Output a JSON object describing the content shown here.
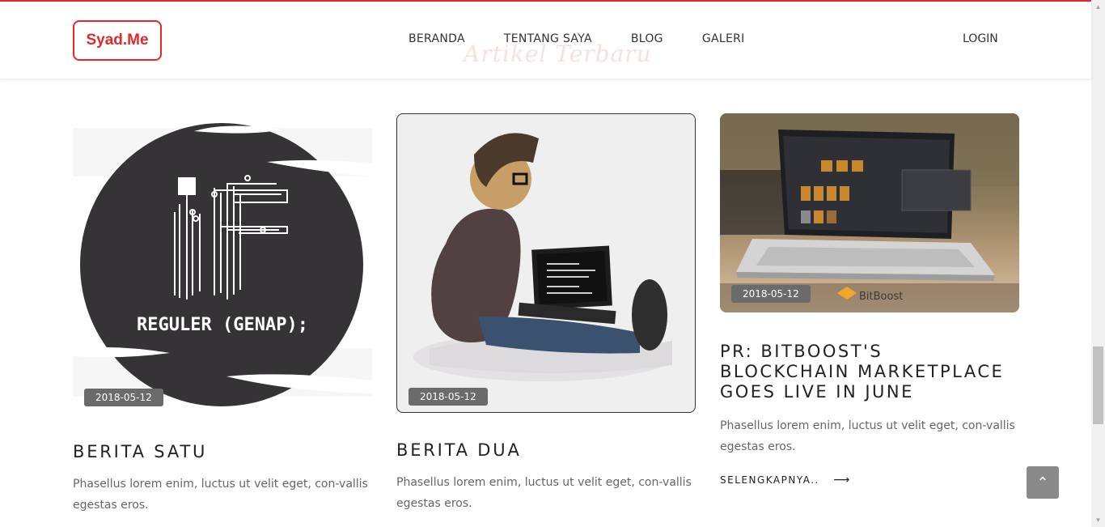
{
  "nav": {
    "logo": "Syad.Me",
    "links": [
      "BERANDA",
      "TENTANG SAYA",
      "BLOG",
      "GALERI"
    ],
    "login": "LOGIN"
  },
  "section": {
    "ghost_title": "Artikel Terbaru"
  },
  "cards": [
    {
      "image_caption": "REGULER (GENAP);",
      "date": "2018-05-12",
      "title": "BERITA SATU",
      "text": "Phasellus lorem enim, luctus ut velit eget, con-vallis egestas eros."
    },
    {
      "date": "2018-05-12",
      "title": "BERITA DUA",
      "text": "Phasellus lorem enim, luctus ut velit eget, con-vallis egestas eros."
    },
    {
      "image_caption": "BitBoost",
      "date": "2018-05-12",
      "title": "PR: BITBOOST'S BLOCKCHAIN MARKETPLACE GOES LIVE IN JUNE",
      "text": "Phasellus lorem enim, luctus ut velit eget, con-vallis egestas eros.",
      "more": "SELENGKAPNYA.."
    }
  ],
  "colors": {
    "accent": "#e02a2a",
    "date_badge": "#6b6b6b",
    "back_to_top": "#8a8a8a"
  },
  "icons": {
    "more_arrow": "long-arrow-right-icon",
    "back_to_top": "double-chevron-up-icon"
  }
}
